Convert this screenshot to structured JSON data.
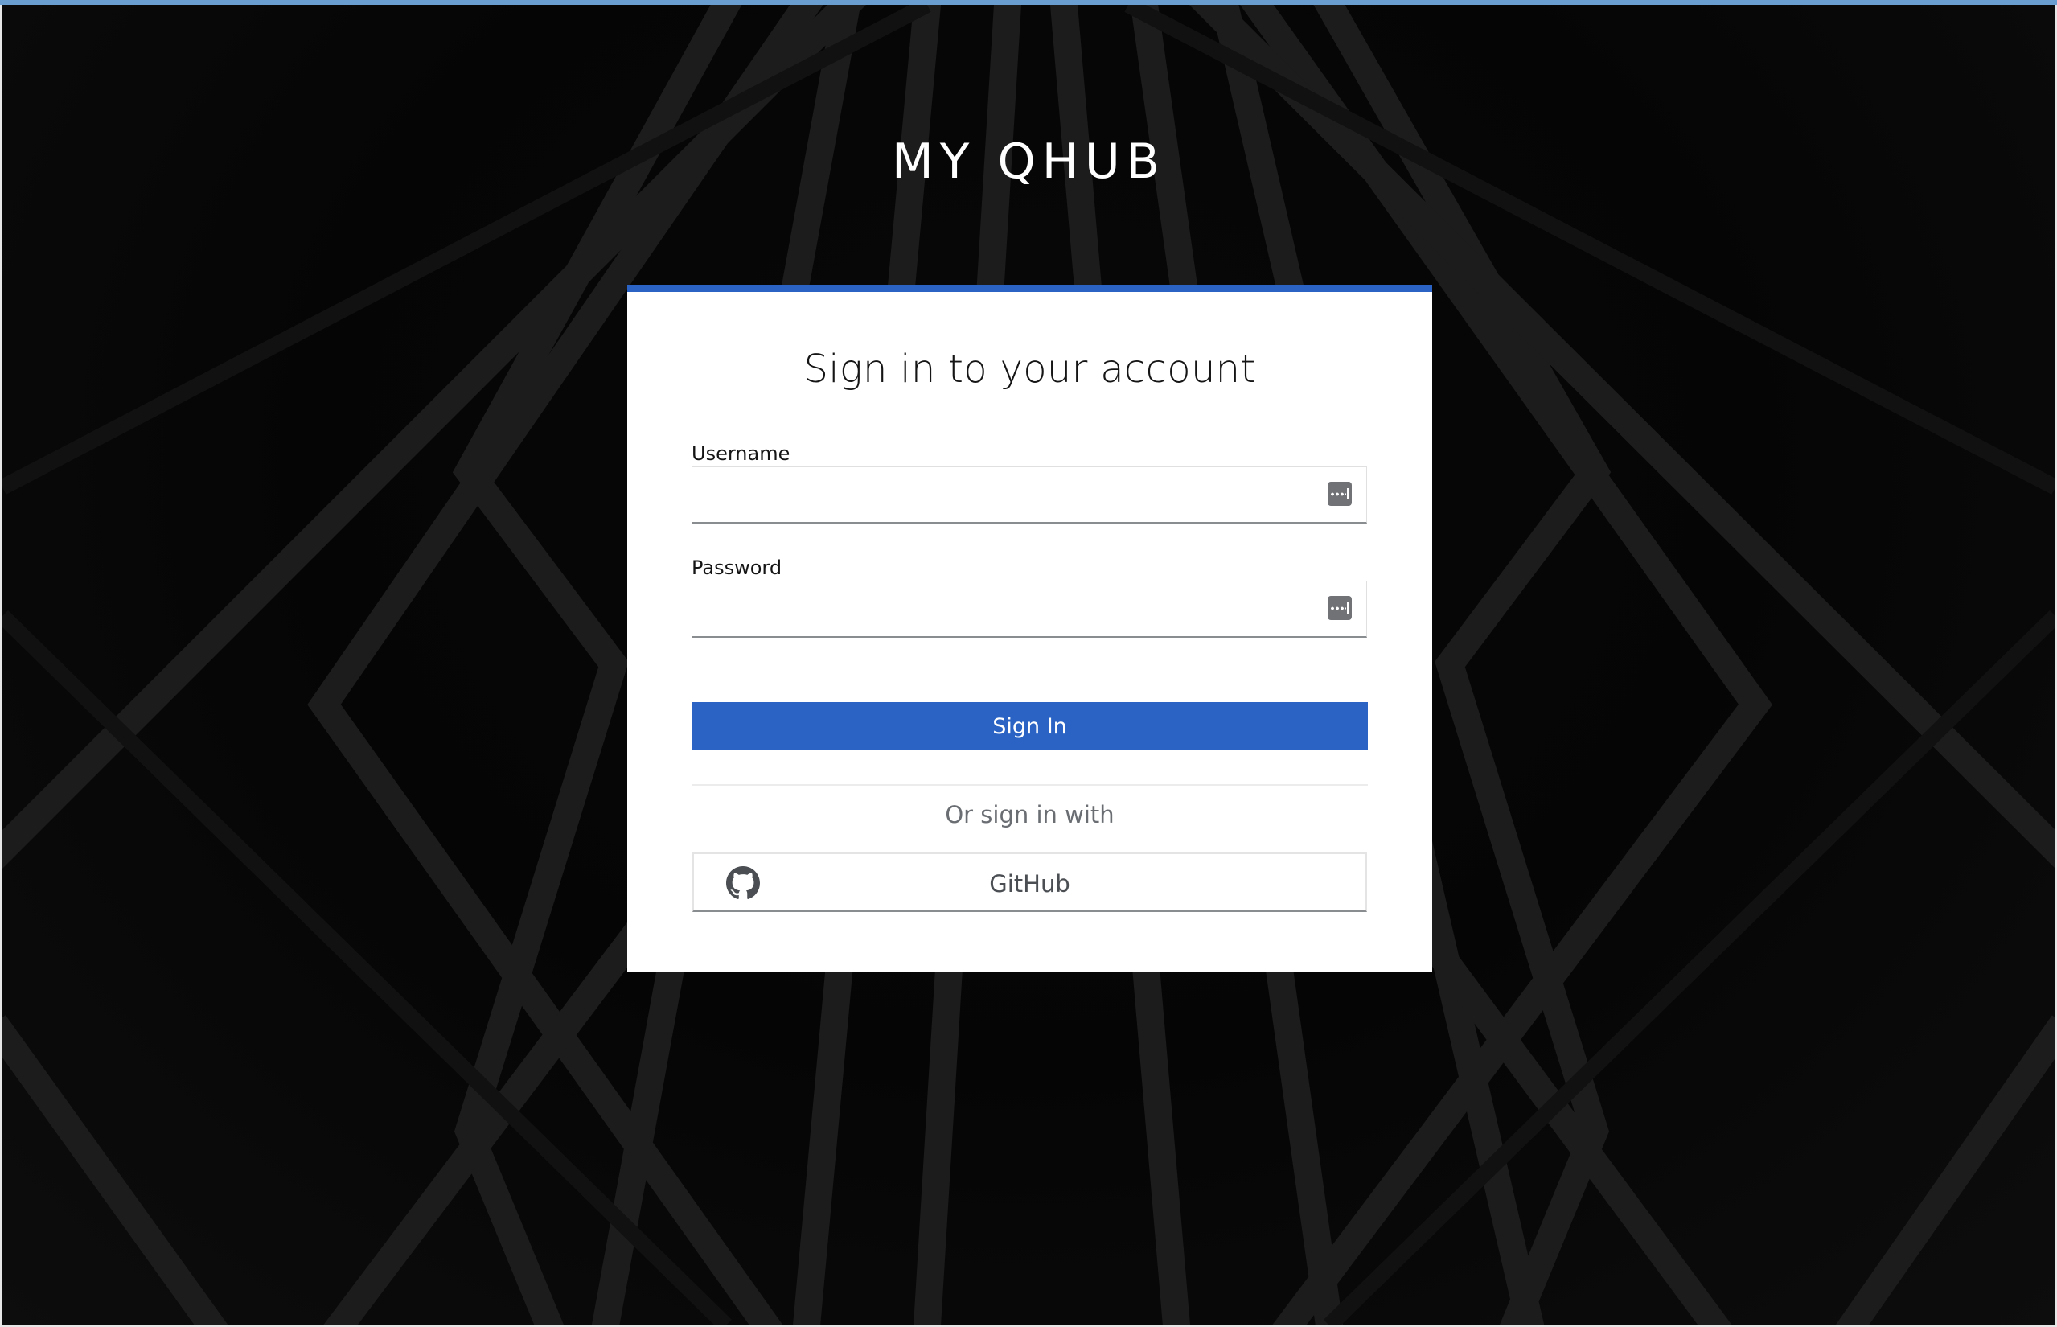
{
  "brand": {
    "title": "MY QHUB"
  },
  "login": {
    "title": "Sign in to your account",
    "username_label": "Username",
    "username_value": "",
    "password_label": "Password",
    "password_value": "",
    "submit_label": "Sign In",
    "alt_text": "Or sign in with",
    "providers": [
      {
        "label": "GitHub",
        "icon": "github-icon"
      }
    ]
  },
  "icons": {
    "password_manager": "password-manager-key-icon",
    "github": "github-icon"
  },
  "colors": {
    "accent": "#2a63c4",
    "background": "#050505",
    "card": "#ffffff",
    "text": "#151515",
    "muted": "#6a6e73"
  }
}
